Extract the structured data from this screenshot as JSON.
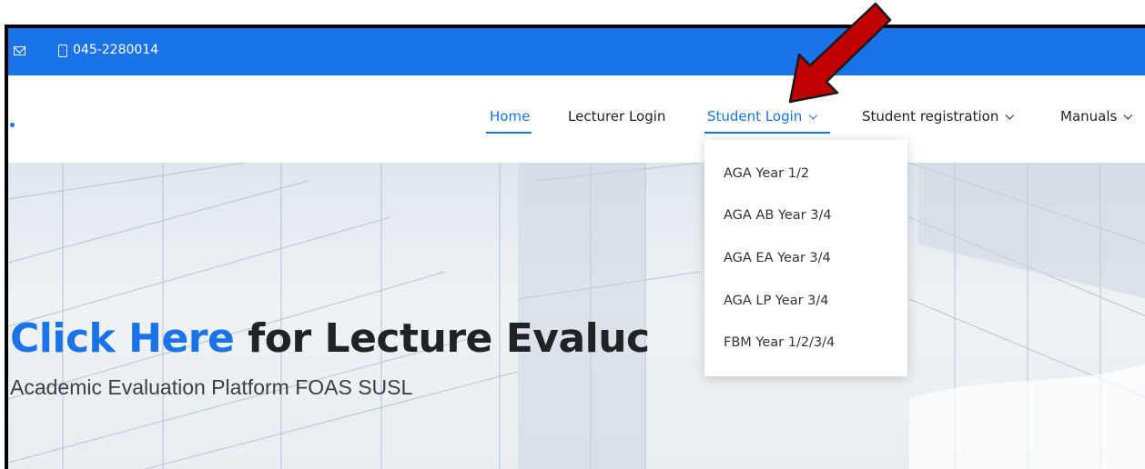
{
  "topbar": {
    "email_icon": "mail-icon",
    "phone_icon": "phone-icon",
    "phone": "045-2280014"
  },
  "nav": {
    "items": [
      {
        "label": "Home",
        "active": true,
        "dropdown": false
      },
      {
        "label": "Lecturer Login",
        "active": false,
        "dropdown": false
      },
      {
        "label": "Student Login",
        "active": false,
        "dropdown": true
      },
      {
        "label": "Student registration",
        "active": false,
        "dropdown": true
      },
      {
        "label": "Manuals",
        "active": false,
        "dropdown": true
      }
    ]
  },
  "dropdown": {
    "items": [
      "AGA Year 1/2",
      "AGA AB Year 3/4",
      "AGA EA Year 3/4",
      "AGA LP Year 3/4",
      "FBM Year 1/2/3/4"
    ]
  },
  "hero": {
    "title_highlight": "Click Here",
    "title_rest": " for Lecture Evaluc",
    "subtitle": "Academic Evaluation Platform FOAS SUSL"
  },
  "colors": {
    "brand_blue": "#1a73e8",
    "annotation_arrow": "#c00000"
  }
}
